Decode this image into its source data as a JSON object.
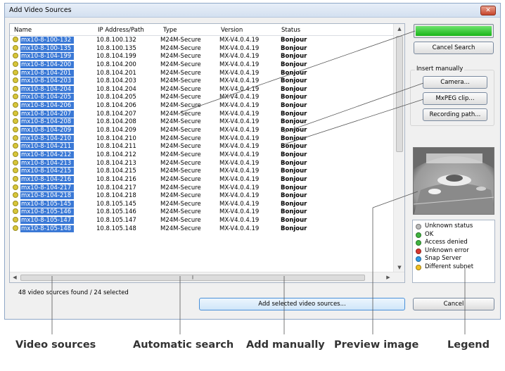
{
  "window": {
    "title": "Add Video Sources",
    "close_glyph": "✕"
  },
  "columns": {
    "name": "Name",
    "ip": "IP Address/Path",
    "type": "Type",
    "version": "Version",
    "status": "Status"
  },
  "rows": [
    {
      "name": "mx10-8-100-132",
      "ip": "10.8.100.132",
      "type": "M24M-Secure",
      "version": "MX-V4.0.4.19",
      "status": "Bonjour"
    },
    {
      "name": "mx10-8-100-135",
      "ip": "10.8.100.135",
      "type": "M24M-Secure",
      "version": "MX-V4.0.4.19",
      "status": "Bonjour"
    },
    {
      "name": "mx10-8-104-199",
      "ip": "10.8.104.199",
      "type": "M24M-Secure",
      "version": "MX-V4.0.4.19",
      "status": "Bonjour"
    },
    {
      "name": "mx10-8-104-200",
      "ip": "10.8.104.200",
      "type": "M24M-Secure",
      "version": "MX-V4.0.4.19",
      "status": "Bonjour"
    },
    {
      "name": "mx10-8-104-201",
      "ip": "10.8.104.201",
      "type": "M24M-Secure",
      "version": "MX-V4.0.4.19",
      "status": "Bonjour"
    },
    {
      "name": "mx10-8-104-203",
      "ip": "10.8.104.203",
      "type": "M24M-Secure",
      "version": "MX-V4.0.4.19",
      "status": "Bonjour"
    },
    {
      "name": "mx10-8-104-204",
      "ip": "10.8.104.204",
      "type": "M24M-Secure",
      "version": "MX-V4.0.4.19",
      "status": "Bonjour"
    },
    {
      "name": "mx10-8-104-205",
      "ip": "10.8.104.205",
      "type": "M24M-Secure",
      "version": "MX-V4.0.4.19",
      "status": "Bonjour"
    },
    {
      "name": "mx10-8-104-206",
      "ip": "10.8.104.206",
      "type": "M24M-Secure",
      "version": "MX-V4.0.4.19",
      "status": "Bonjour"
    },
    {
      "name": "mx10-8-104-207",
      "ip": "10.8.104.207",
      "type": "M24M-Secure",
      "version": "MX-V4.0.4.19",
      "status": "Bonjour"
    },
    {
      "name": "mx10-8-104-208",
      "ip": "10.8.104.208",
      "type": "M24M-Secure",
      "version": "MX-V4.0.4.19",
      "status": "Bonjour"
    },
    {
      "name": "mx10-8-104-209",
      "ip": "10.8.104.209",
      "type": "M24M-Secure",
      "version": "MX-V4.0.4.19",
      "status": "Bonjour"
    },
    {
      "name": "mx10-8-104-210",
      "ip": "10.8.104.210",
      "type": "M24M-Secure",
      "version": "MX-V4.0.4.19",
      "status": "Bonjour"
    },
    {
      "name": "mx10-8-104-211",
      "ip": "10.8.104.211",
      "type": "M24M-Secure",
      "version": "MX-V4.0.4.19",
      "status": "Bonjour"
    },
    {
      "name": "mx10-8-104-212",
      "ip": "10.8.104.212",
      "type": "M24M-Secure",
      "version": "MX-V4.0.4.19",
      "status": "Bonjour"
    },
    {
      "name": "mx10-8-104-213",
      "ip": "10.8.104.213",
      "type": "M24M-Secure",
      "version": "MX-V4.0.4.19",
      "status": "Bonjour"
    },
    {
      "name": "mx10-8-104-215",
      "ip": "10.8.104.215",
      "type": "M24M-Secure",
      "version": "MX-V4.0.4.19",
      "status": "Bonjour"
    },
    {
      "name": "mx10-8-104-216",
      "ip": "10.8.104.216",
      "type": "M24M-Secure",
      "version": "MX-V4.0.4.19",
      "status": "Bonjour"
    },
    {
      "name": "mx10-8-104-217",
      "ip": "10.8.104.217",
      "type": "M24M-Secure",
      "version": "MX-V4.0.4.19",
      "status": "Bonjour"
    },
    {
      "name": "mx10-8-104-218",
      "ip": "10.8.104.218",
      "type": "M24M-Secure",
      "version": "MX-V4.0.4.19",
      "status": "Bonjour"
    },
    {
      "name": "mx10-8-105-145",
      "ip": "10.8.105.145",
      "type": "M24M-Secure",
      "version": "MX-V4.0.4.19",
      "status": "Bonjour"
    },
    {
      "name": "mx10-8-105-146",
      "ip": "10.8.105.146",
      "type": "M24M-Secure",
      "version": "MX-V4.0.4.19",
      "status": "Bonjour"
    },
    {
      "name": "mx10-8-105-147",
      "ip": "10.8.105.147",
      "type": "M24M-Secure",
      "version": "MX-V4.0.4.19",
      "status": "Bonjour"
    },
    {
      "name": "mx10-8-105-148",
      "ip": "10.8.105.148",
      "type": "M24M-Secure",
      "version": "MX-V4.0.4.19",
      "status": "Bonjour"
    }
  ],
  "footer": {
    "count_text": "48 video sources found / 24 selected",
    "add_button": "Add selected video sources...",
    "cancel_button": "Cancel"
  },
  "search": {
    "progress_percent": 100,
    "cancel_search_button": "Cancel Search"
  },
  "insert_manually": {
    "label": "Insert manually",
    "camera_button": "Camera...",
    "mxpeg_button": "MxPEG clip...",
    "recording_button": "Recording path..."
  },
  "legend": [
    {
      "label": "Unknown status",
      "color": "#b9b9b9"
    },
    {
      "label": "OK",
      "color": "#3fb43f"
    },
    {
      "label": "Access denied",
      "color": "#3fb43f"
    },
    {
      "label": "Unknown error",
      "color": "#d8372f"
    },
    {
      "label": "Snap Server",
      "color": "#2f9be8"
    },
    {
      "label": "Different subnet",
      "color": "#f2c021"
    }
  ],
  "callouts": {
    "video_sources": "Video sources",
    "automatic_search": "Automatic search",
    "add_manually": "Add manually",
    "preview_image": "Preview image",
    "legend": "Legend"
  },
  "colors": {
    "selection": "#3b79d6",
    "progress": "#19b519",
    "bonjour_dot": "#d8c63a"
  }
}
